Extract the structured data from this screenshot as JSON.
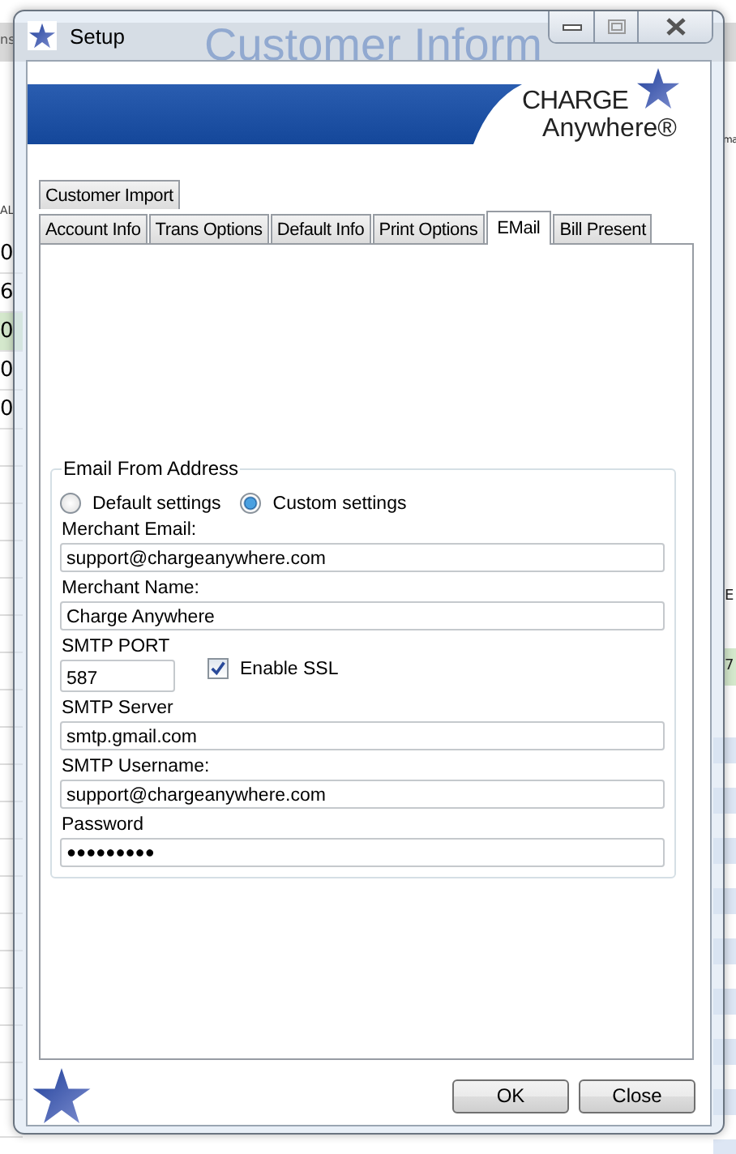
{
  "background": {
    "title": "Customer Inform",
    "corner_text": "ns",
    "column_header": "AL",
    "left_cells": [
      {
        "text": "0",
        "selected": false
      },
      {
        "text": "6",
        "selected": false
      },
      {
        "text": "0",
        "selected": true
      },
      {
        "text": "0",
        "selected": false
      },
      {
        "text": "0",
        "selected": false
      }
    ],
    "right_fragments": [
      {
        "text": "ma",
        "selected": false
      },
      {
        "text": "E",
        "selected": false
      },
      {
        "text": "7",
        "selected": true
      }
    ]
  },
  "window": {
    "title": "Setup"
  },
  "logo": {
    "line1": "CHARGE",
    "line2": "Anywhere®"
  },
  "tab_rows": [
    [
      {
        "label": "Customer Import",
        "selected": false
      }
    ],
    [
      {
        "label": "Account Info",
        "selected": false
      },
      {
        "label": "Trans Options",
        "selected": false
      },
      {
        "label": "Default Info",
        "selected": false
      },
      {
        "label": "Print Options",
        "selected": false
      },
      {
        "label": "EMail",
        "selected": true
      },
      {
        "label": "Bill Present",
        "selected": false
      }
    ]
  ],
  "group": {
    "title": "Email From Address",
    "radios": [
      {
        "label": "Default settings",
        "selected": false
      },
      {
        "label": "Custom settings",
        "selected": true
      }
    ],
    "fields": [
      {
        "kind": "text",
        "label": "Merchant Email:",
        "value": "support@chargeanywhere.com"
      },
      {
        "kind": "text",
        "label": "Merchant Name:",
        "value": "Charge Anywhere"
      },
      {
        "kind": "port",
        "label": "SMTP PORT",
        "value": "587",
        "checkbox": {
          "label": "Enable SSL",
          "checked": true
        }
      },
      {
        "kind": "text",
        "label": "SMTP Server",
        "value": "smtp.gmail.com"
      },
      {
        "kind": "text",
        "label": "SMTP Username:",
        "value": "support@chargeanywhere.com"
      },
      {
        "kind": "password",
        "label": "Password",
        "value": "●●●●●●●●●"
      }
    ]
  },
  "buttons": [
    "OK",
    "Close"
  ]
}
